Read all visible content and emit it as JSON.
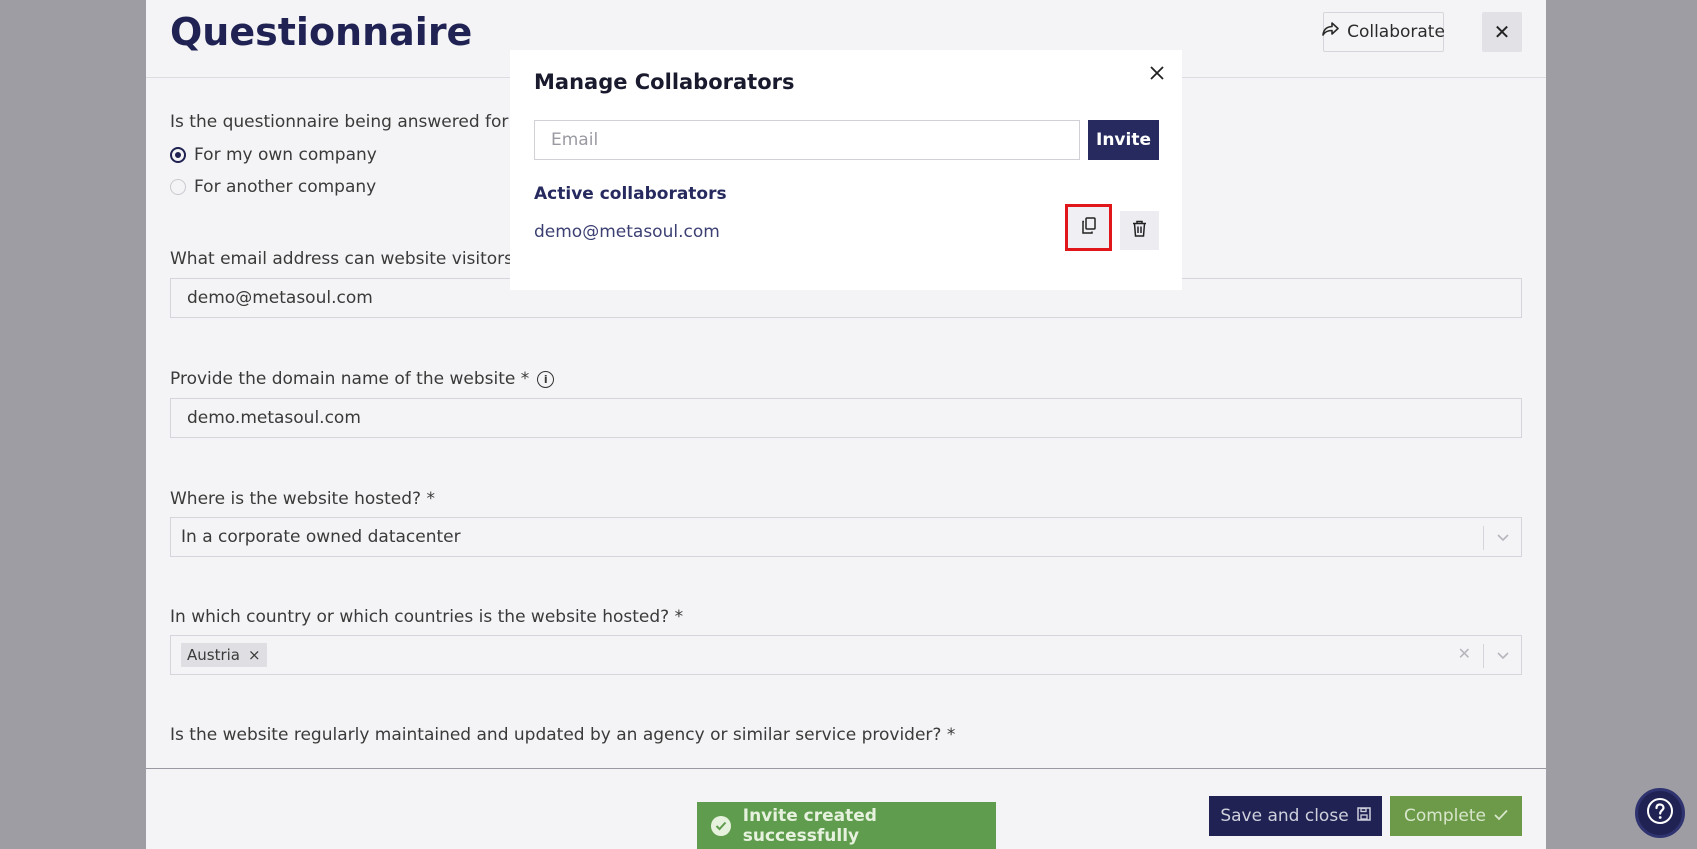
{
  "page": {
    "title": "Questionnaire",
    "collaborate_label": "Collaborate",
    "close_label": "✕"
  },
  "questions": {
    "q1": {
      "label": "Is the questionnaire being answered for your",
      "options": [
        "For my own company",
        "For another company"
      ],
      "selected": "For my own company"
    },
    "q2": {
      "label": "What email address can website visitors use",
      "value": "demo@metasoul.com"
    },
    "q3": {
      "label": "Provide the domain name of the website *",
      "value": "demo.metasoul.com"
    },
    "q4": {
      "label": "Where is the website hosted? *",
      "value": "In a corporate owned datacenter"
    },
    "q5": {
      "label": "In which country or which countries is the website hosted? *",
      "tags": [
        "Austria"
      ]
    },
    "q6": {
      "label": "Is the website regularly maintained and updated by an agency or similar service provider? *"
    }
  },
  "footer": {
    "save_label": "Save and close",
    "complete_label": "Complete"
  },
  "toast": {
    "message": "Invite created successfully"
  },
  "modal": {
    "title": "Manage Collaborators",
    "email_placeholder": "Email",
    "invite_label": "Invite",
    "section_label": "Active collaborators",
    "collaborators": [
      "demo@metasoul.com"
    ]
  },
  "colors": {
    "brand_navy": "#1f2252",
    "success_green": "#5f9c4d",
    "highlight_red": "#e0161b"
  }
}
